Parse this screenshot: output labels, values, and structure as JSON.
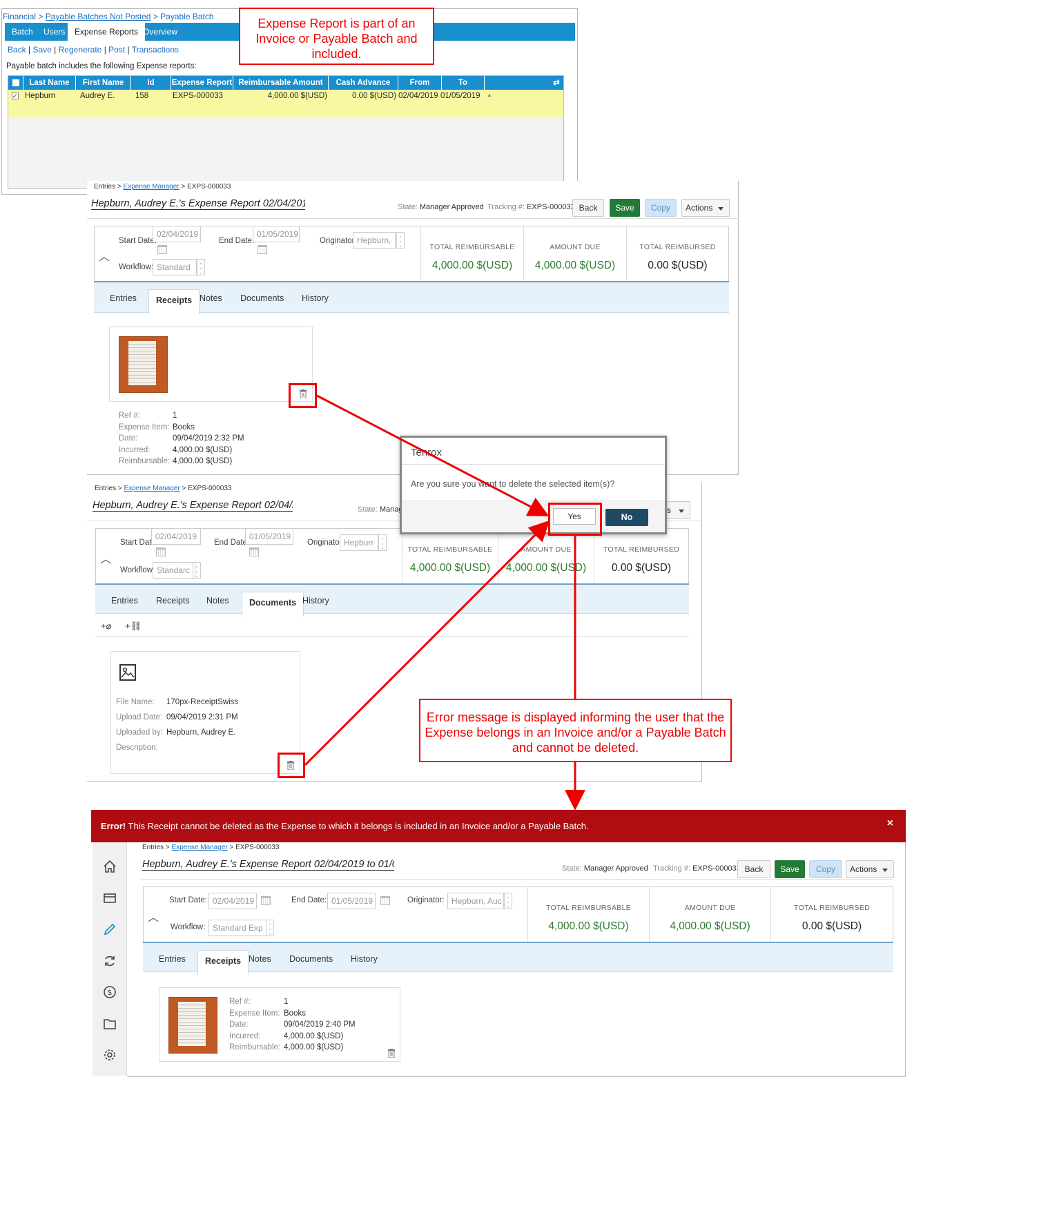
{
  "panel1": {
    "breadcrumb": {
      "root": "Financial",
      "sep1": " > ",
      "mid": "Payable Batches Not Posted",
      "sep2": " > ",
      "current": "Payable Batch"
    },
    "tabs": [
      "Batch",
      "Users",
      "Expense Reports",
      "Overview"
    ],
    "actions": {
      "back": "Back",
      "save": "Save",
      "regenerate": "Regenerate",
      "post": "Post",
      "transactions": "Transactions",
      "sep": " | "
    },
    "intro": "Payable batch includes the following Expense reports:",
    "columns": [
      "Last Name",
      "First Name",
      "Id",
      "Expense Report",
      "Reimbursable Amount",
      "Cash Advance",
      "From",
      "To"
    ],
    "row": {
      "last": "Hepburn",
      "first": "Audrey E.",
      "id": "158",
      "report": "EXPS-000033",
      "reimb": "4,000.00 $(USD)",
      "advance": "0.00 $(USD)",
      "from": "02/04/2019",
      "to": "01/05/2019"
    }
  },
  "report": {
    "crumb_root": "Entries >",
    "crumb_link": "Expense Manager",
    "crumb_end": "> EXPS-000033",
    "title_a": "Hepburn, Audrey E.'s Expense Report 02/04/2019",
    "title_b": "Hepburn, Audrey E.'s Expense Report 02/04/20",
    "title_c": "Hepburn, Audrey E.'s Expense Report 02/04/2019 to 01/05/2",
    "state_label": "State:",
    "state": "Manager Approved",
    "state_trunc": "Manag",
    "tracking_label": "Tracking #:",
    "tracking": "EXPS-000033",
    "back": "Back",
    "save": "Save",
    "copy": "Copy",
    "actions": "Actions",
    "actions_trunc": "s",
    "start_label": "Start Date:",
    "end_label": "End Date:",
    "orig_label": "Originator:",
    "orig_label_b": "Originator",
    "workflow_label": "Workflow:",
    "start": "02/04/2019",
    "end": "01/05/2019",
    "orig_a": "Hepburn,",
    "orig_b": "Hepburr",
    "orig_c": "Hepburn, Auc",
    "wf_a": "Standard",
    "wf_b": "Standarc",
    "wf_c": "Standard Exp",
    "tot_reimbursable": "TOTAL REIMBURSABLE",
    "amount_due": "AMOUNT DUE",
    "tot_reimbursed": "TOTAL REIMBURSED",
    "v_reimbursable": "4,000.00 $(USD)",
    "v_due": "4,000.00 $(USD)",
    "v_reimbursed": "0.00 $(USD)",
    "tabs": [
      "Entries",
      "Receipts",
      "Notes",
      "Documents",
      "History"
    ]
  },
  "receipt": {
    "labels": [
      "Ref #:",
      "Expense Item:",
      "Date:",
      "Incurred:",
      "Reimbursable:"
    ],
    "values_a": [
      "1",
      "Books",
      "09/04/2019 2:32 PM",
      "4,000.00 $(USD)",
      "4,000.00 $(USD)"
    ],
    "values_c": [
      "1",
      "Books",
      "09/04/2019 2:40 PM",
      "4,000.00 $(USD)",
      "4,000.00 $(USD)"
    ]
  },
  "document": {
    "add_attach": "+",
    "add_link": "+",
    "labels": [
      "File Name:",
      "Upload Date:",
      "Uploaded by:",
      "Description:"
    ],
    "values": [
      "170px-ReceiptSwiss",
      "09/04/2019 2:31 PM",
      "Hepburn, Audrey E.",
      ""
    ]
  },
  "modal": {
    "title": "Tenrox",
    "body": "Are you sure you want to delete the selected item(s)?",
    "yes": "Yes",
    "no": "No"
  },
  "callouts": {
    "top": "Expense Report is part of an Invoice or Payable Batch and included.",
    "error": "Error message is displayed informing the user that the Expense belongs in an Invoice and/or a Payable Batch and cannot be deleted."
  },
  "error": {
    "label": "Error!",
    "text": " This Receipt cannot be deleted as the Expense to which it belongs is included in an Invoice and/or a Payable Batch.",
    "close": "×"
  },
  "colors": {
    "accent": "#1a8fce",
    "save": "#237a37",
    "error": "#b00d12",
    "annotation": "#ee0000",
    "total": "#2d7a31"
  }
}
